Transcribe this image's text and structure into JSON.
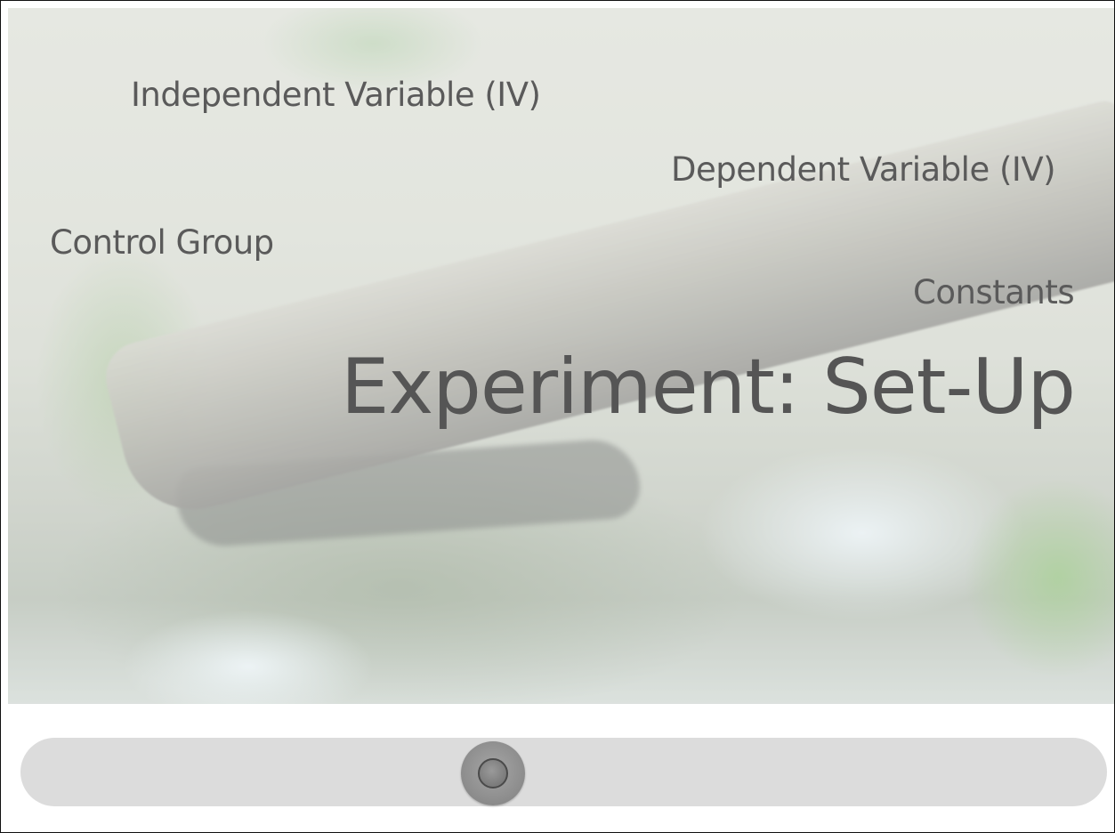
{
  "slide": {
    "background_image": "forest-pond-log-photo",
    "labels": {
      "independent_variable": "Independent Variable (IV)",
      "dependent_variable": "Dependent Variable (IV)",
      "control_group": "Control Group",
      "constants": "Constants"
    },
    "title": "Experiment: Set-Up",
    "text_color": "#5a5a5a"
  },
  "slider": {
    "value": 0.435,
    "track_color": "#dcdcdc",
    "knob_color": "#8f8f8f"
  }
}
